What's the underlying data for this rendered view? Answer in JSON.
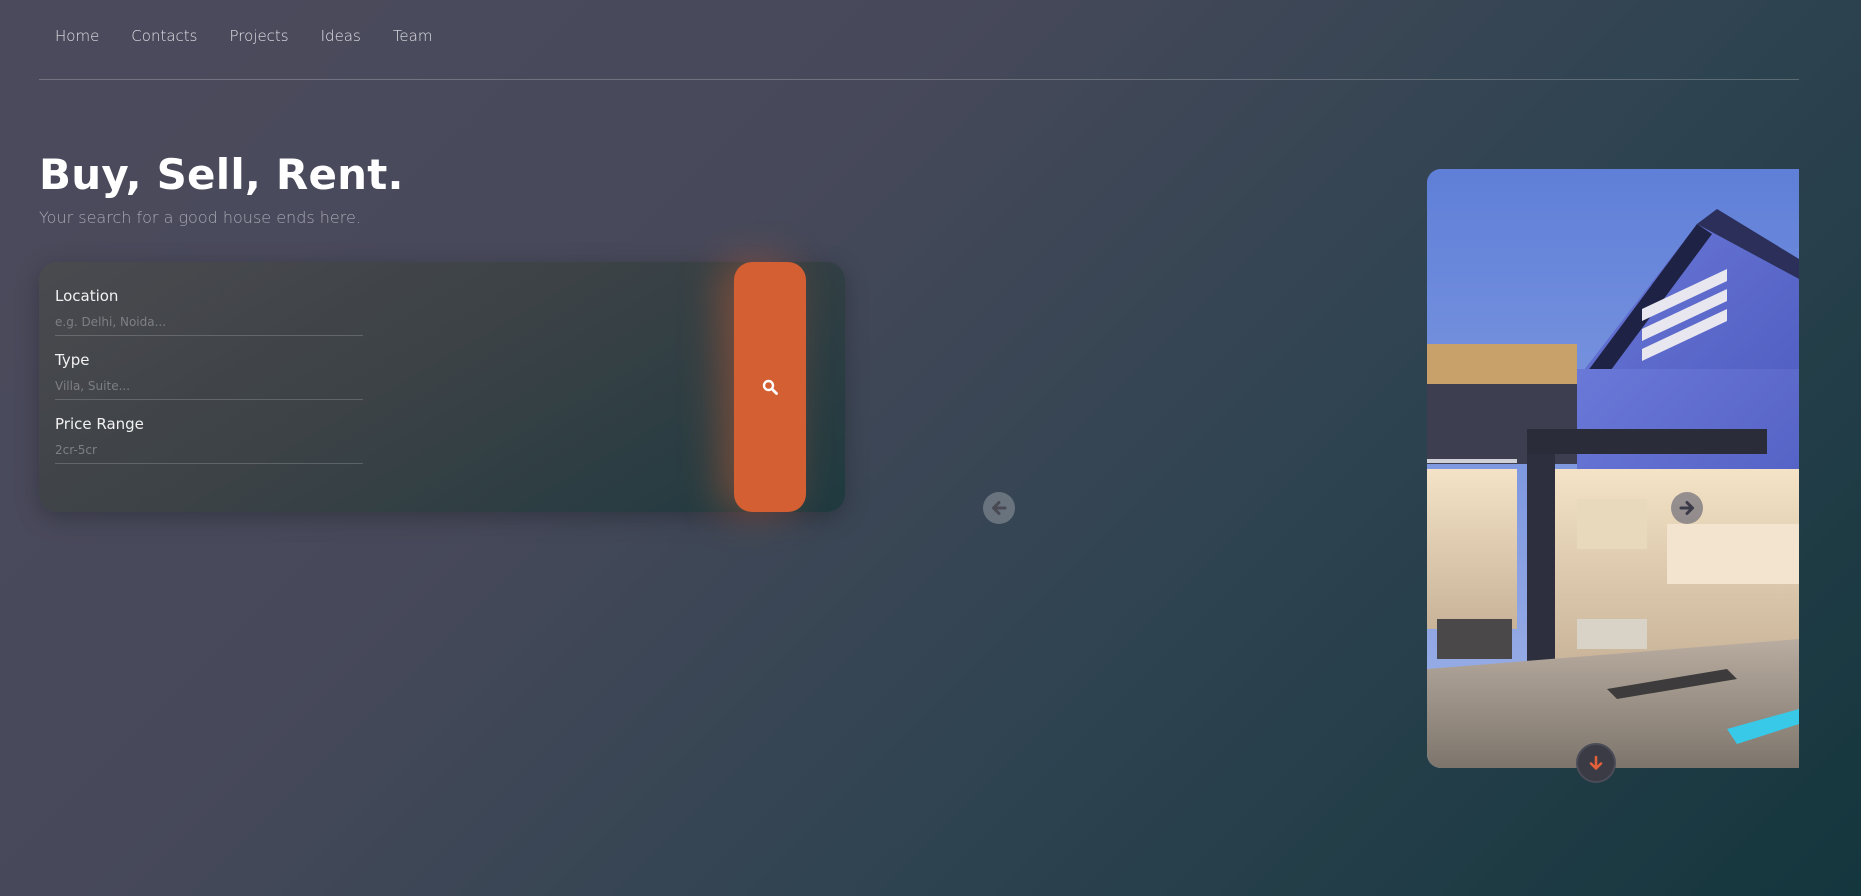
{
  "nav": {
    "items": [
      {
        "label": "Home"
      },
      {
        "label": "Contacts"
      },
      {
        "label": "Projects"
      },
      {
        "label": "Ideas"
      },
      {
        "label": "Team"
      }
    ]
  },
  "hero": {
    "title": "Buy, Sell, Rent.",
    "subtitle": "Your search for a good house ends here."
  },
  "search": {
    "fields": [
      {
        "label": "Location",
        "placeholder": "e.g. Delhi, Noida..."
      },
      {
        "label": "Type",
        "placeholder": "Villa, Suite..."
      },
      {
        "label": "Price Range",
        "placeholder": "2cr-5cr"
      }
    ],
    "button_icon": "search-icon"
  },
  "slider": {
    "prev_icon": "arrow-left-icon",
    "next_icon": "arrow-right-icon",
    "image": "modern-house-photo"
  },
  "scroll": {
    "icon": "arrow-down-icon"
  },
  "colors": {
    "accent": "#d35f33",
    "text_muted": "#a9a8b4"
  }
}
